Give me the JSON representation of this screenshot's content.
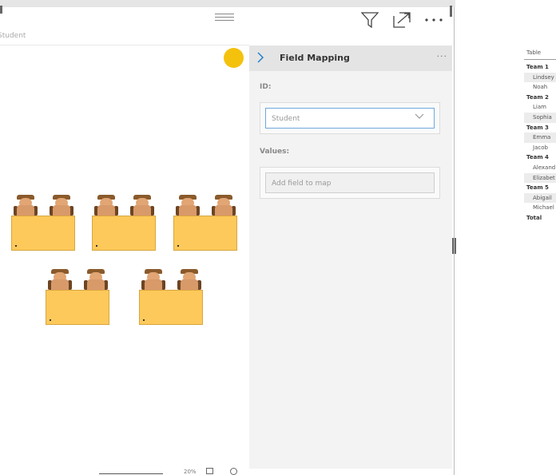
{
  "visual": {
    "breadcrumb": "Student",
    "zoom": "20%"
  },
  "seating": {
    "accent_color": "#f4c20d",
    "desk_color": "#fdc95a",
    "desks_row1": 3,
    "desks_row2": 2,
    "seats_per_desk": 2
  },
  "pane": {
    "title": "Field Mapping",
    "more": "···",
    "id_label": "ID:",
    "id_value": "Student",
    "values_label": "Values:",
    "values_placeholder": "Add field to map"
  },
  "table": {
    "header": "Table",
    "rows": [
      {
        "label": "Team 1",
        "type": "group"
      },
      {
        "label": "Lindsey",
        "type": "item",
        "shade": true
      },
      {
        "label": "Noah",
        "type": "item",
        "shade": false
      },
      {
        "label": "Team 2",
        "type": "group"
      },
      {
        "label": "Liam",
        "type": "item",
        "shade": false
      },
      {
        "label": "Sophia",
        "type": "item",
        "shade": true
      },
      {
        "label": "Team 3",
        "type": "group"
      },
      {
        "label": "Emma",
        "type": "item",
        "shade": true
      },
      {
        "label": "Jacob",
        "type": "item",
        "shade": false
      },
      {
        "label": "Team 4",
        "type": "group"
      },
      {
        "label": "Alexand",
        "type": "item",
        "shade": false
      },
      {
        "label": "Elizabet",
        "type": "item",
        "shade": true
      },
      {
        "label": "Team 5",
        "type": "group"
      },
      {
        "label": "Abigail",
        "type": "item",
        "shade": true
      },
      {
        "label": "Michael",
        "type": "item",
        "shade": false
      },
      {
        "label": "Total",
        "type": "group"
      }
    ]
  }
}
